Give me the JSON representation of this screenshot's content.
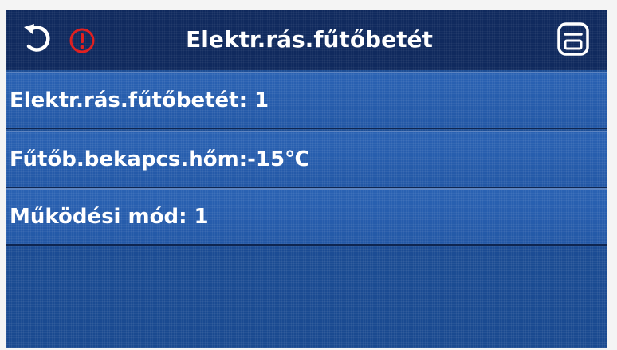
{
  "header": {
    "title": "Elektr.rás.fűtőbetét",
    "back_icon": "back-arrow-icon",
    "alarm_icon": "alarm-icon",
    "save_icon": "save-icon",
    "alarm_color": "#e02020"
  },
  "settings": [
    {
      "label": "Elektr.rás.fűtőbetét: 1"
    },
    {
      "label": "Fűtőb.bekapcs.hőm:-15℃"
    },
    {
      "label": "Működési mód: 1"
    }
  ],
  "colors": {
    "header_bg": "#102a5e",
    "row_bg": "#2358a6",
    "text": "#ffffff"
  }
}
